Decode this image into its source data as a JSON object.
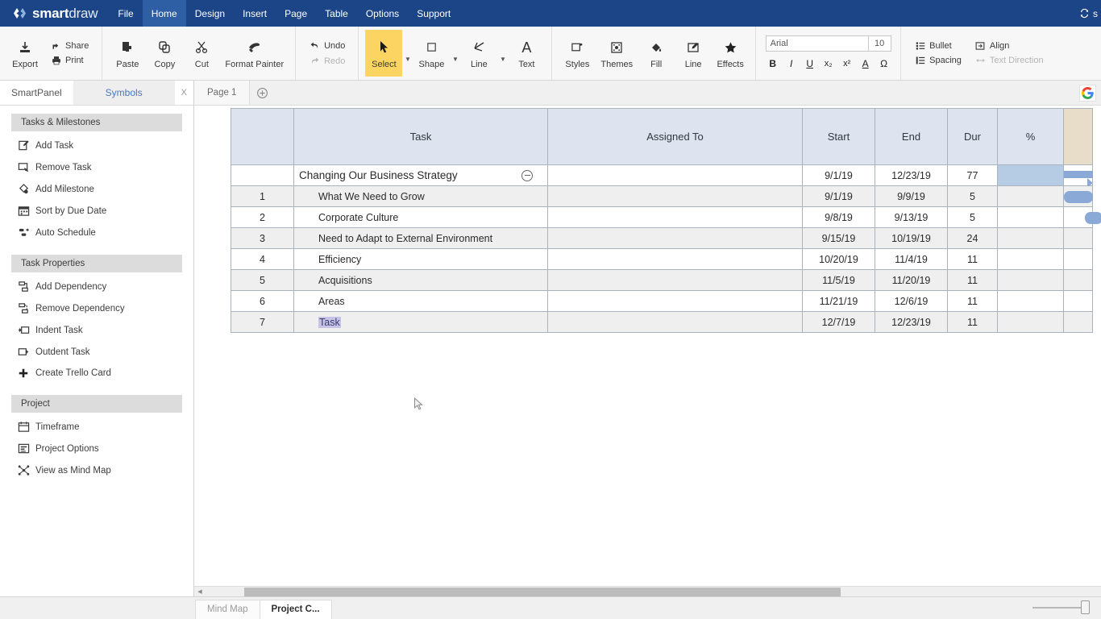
{
  "app": {
    "brand_bold": "smart",
    "brand_light": "draw",
    "logo_icon": "smartdraw-diamond-logo",
    "accent_blue": "#1b4586",
    "menu_active_bg": "#2e5ea3",
    "select_tool_bg": "#fcd462",
    "table_header_bg": "#dde3ef",
    "gantt_bar_color": "#8aa9d6",
    "selection_highlight": "#c7c3e8"
  },
  "menubar": {
    "items": [
      {
        "label": "File",
        "active": false
      },
      {
        "label": "Home",
        "active": true
      },
      {
        "label": "Design",
        "active": false
      },
      {
        "label": "Insert",
        "active": false
      },
      {
        "label": "Page",
        "active": false
      },
      {
        "label": "Table",
        "active": false
      },
      {
        "label": "Options",
        "active": false
      },
      {
        "label": "Support",
        "active": false
      }
    ],
    "right_text": "s",
    "sync_icon": "sync-icon"
  },
  "ribbon": {
    "group_file": {
      "export_label": "Export",
      "export_icon": "export-download-icon",
      "share_label": "Share",
      "share_icon": "share-icon",
      "print_label": "Print",
      "print_icon": "printer-icon"
    },
    "group_clipboard": [
      {
        "label": "Paste",
        "icon": "paste-icon"
      },
      {
        "label": "Copy",
        "icon": "copy-icon"
      },
      {
        "label": "Cut",
        "icon": "scissors-icon"
      },
      {
        "label": "Format Painter",
        "icon": "format-painter-icon"
      }
    ],
    "group_history": {
      "undo_label": "Undo",
      "undo_icon": "undo-arrow-icon",
      "redo_label": "Redo",
      "redo_icon": "redo-arrow-icon"
    },
    "group_tools": [
      {
        "label": "Select",
        "icon": "cursor-arrow-icon",
        "selected": true,
        "has_caret": true
      },
      {
        "label": "Shape",
        "icon": "square-shape-icon",
        "selected": false,
        "has_caret": true
      },
      {
        "label": "Line",
        "icon": "line-angle-icon",
        "selected": false,
        "has_caret": true
      },
      {
        "label": "Text",
        "icon": "letter-a-icon",
        "selected": false,
        "has_caret": false
      }
    ],
    "group_format": [
      {
        "label": "Styles",
        "icon": "styles-icon"
      },
      {
        "label": "Themes",
        "icon": "themes-grid-icon"
      },
      {
        "label": "Fill",
        "icon": "paint-bucket-icon"
      },
      {
        "label": "Line",
        "icon": "pencil-edit-icon"
      },
      {
        "label": "Effects",
        "icon": "star-icon"
      }
    ],
    "font": {
      "family_value": "Arial",
      "size_value": "10",
      "buttons": [
        {
          "label": "B",
          "name": "bold-button"
        },
        {
          "label": "I",
          "name": "italic-button"
        },
        {
          "label": "U",
          "name": "underline-button"
        },
        {
          "label": "x₂",
          "name": "subscript-button"
        },
        {
          "label": "x²",
          "name": "superscript-button"
        },
        {
          "label": "A",
          "name": "font-color-button"
        },
        {
          "label": "Ω",
          "name": "symbol-button"
        }
      ]
    },
    "group_paragraph": [
      {
        "label": "Bullet",
        "icon": "bullet-list-icon",
        "dim": false
      },
      {
        "label": "Align",
        "icon": "align-icon",
        "dim": false
      },
      {
        "label": "Spacing",
        "icon": "line-spacing-icon",
        "dim": false
      },
      {
        "label": "Text Direction",
        "icon": "text-direction-icon",
        "dim": true
      }
    ]
  },
  "sidebar": {
    "tabs": [
      {
        "label": "SmartPanel",
        "active": false
      },
      {
        "label": "Symbols",
        "active": true
      }
    ],
    "close_label": "X",
    "sections": [
      {
        "title": "Tasks & Milestones",
        "items": [
          {
            "label": "Add Task",
            "icon": "add-task-icon"
          },
          {
            "label": "Remove Task",
            "icon": "remove-task-icon"
          },
          {
            "label": "Add Milestone",
            "icon": "add-milestone-icon"
          },
          {
            "label": "Sort by Due Date",
            "icon": "calendar-sort-icon"
          },
          {
            "label": "Auto Schedule",
            "icon": "auto-schedule-icon"
          }
        ]
      },
      {
        "title": "Task Properties",
        "items": [
          {
            "label": "Add Dependency",
            "icon": "add-dependency-icon"
          },
          {
            "label": "Remove Dependency",
            "icon": "remove-dependency-icon"
          },
          {
            "label": "Indent Task",
            "icon": "indent-task-icon"
          },
          {
            "label": "Outdent Task",
            "icon": "outdent-task-icon"
          },
          {
            "label": "Create Trello Card",
            "icon": "plus-icon"
          }
        ]
      },
      {
        "title": "Project",
        "items": [
          {
            "label": "Timeframe",
            "icon": "calendar-icon"
          },
          {
            "label": "Project Options",
            "icon": "project-options-icon"
          },
          {
            "label": "View as Mind Map",
            "icon": "mind-map-icon"
          }
        ]
      }
    ]
  },
  "canvas": {
    "page_tab": "Page 1",
    "add_page_icon": "add-page-plus-icon",
    "google_icon": "google-g-icon"
  },
  "chart_data": {
    "type": "table",
    "title": "Changing Our Business Strategy",
    "columns": [
      "",
      "Task",
      "Assigned To",
      "Start",
      "End",
      "Dur",
      "%",
      ""
    ],
    "rows": [
      {
        "num": "",
        "task": "Changing Our Business Strategy",
        "assigned": "",
        "start": "9/1/19",
        "end": "12/23/19",
        "dur": "77",
        "pct": "",
        "is_summary": true,
        "collapsible": true,
        "pct_selected": true,
        "bar": "summary"
      },
      {
        "num": "1",
        "task": "What We Need to Grow",
        "assigned": "",
        "start": "9/1/19",
        "end": "9/9/19",
        "dur": "5",
        "pct": "",
        "is_summary": false,
        "collapsible": false,
        "pct_selected": false,
        "bar": "task"
      },
      {
        "num": "2",
        "task": "Corporate Culture",
        "assigned": "",
        "start": "9/8/19",
        "end": "9/13/19",
        "dur": "5",
        "pct": "",
        "is_summary": false,
        "collapsible": false,
        "pct_selected": false,
        "bar": "task2"
      },
      {
        "num": "3",
        "task": "Need to Adapt to External Environment",
        "assigned": "",
        "start": "9/15/19",
        "end": "10/19/19",
        "dur": "24",
        "pct": "",
        "is_summary": false,
        "collapsible": false,
        "pct_selected": false,
        "bar": "none"
      },
      {
        "num": "4",
        "task": "Efficiency",
        "assigned": "",
        "start": "10/20/19",
        "end": "11/4/19",
        "dur": "11",
        "pct": "",
        "is_summary": false,
        "collapsible": false,
        "pct_selected": false,
        "bar": "none"
      },
      {
        "num": "5",
        "task": "Acquisitions",
        "assigned": "",
        "start": "11/5/19",
        "end": "11/20/19",
        "dur": "11",
        "pct": "",
        "is_summary": false,
        "collapsible": false,
        "pct_selected": false,
        "bar": "none"
      },
      {
        "num": "6",
        "task": "Areas",
        "assigned": "",
        "start": "11/21/19",
        "end": "12/6/19",
        "dur": "11",
        "pct": "",
        "is_summary": false,
        "collapsible": false,
        "pct_selected": false,
        "bar": "none"
      },
      {
        "num": "7",
        "task": "Task",
        "assigned": "",
        "start": "12/7/19",
        "end": "12/23/19",
        "dur": "11",
        "pct": "",
        "is_summary": false,
        "collapsible": false,
        "pct_selected": false,
        "bar": "none",
        "text_selected": true
      }
    ]
  },
  "bottom": {
    "sheet_tabs": [
      {
        "label": "Mind Map",
        "active": false
      },
      {
        "label": "Project C...",
        "active": true
      }
    ],
    "zoom_slider": "zoom-slider"
  }
}
